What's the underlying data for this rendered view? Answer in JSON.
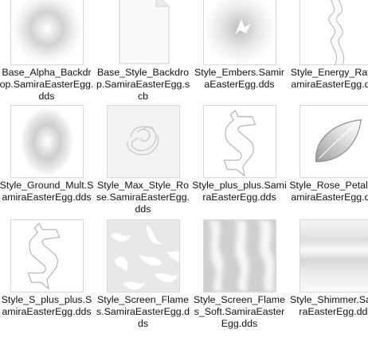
{
  "files": [
    {
      "name": "Base_Alpha_Backdrop.SamiraEasterEgg.dds",
      "icon": "radial-glow-thumbnail"
    },
    {
      "name": "Base_Style_Backdrop.SamiraEasterEgg.scb",
      "icon": "blank-document-icon"
    },
    {
      "name": "Style_Embers.SamiraEasterEgg.dds",
      "icon": "ember-spark-thumbnail"
    },
    {
      "name": "Style_Energy_Ray.SamiraEasterEgg.dds",
      "icon": "energy-ray-thumbnail"
    },
    {
      "name": "Style_Ground_Mult.SamiraEasterEgg.dds",
      "icon": "oval-glow-thumbnail"
    },
    {
      "name": "Style_Max_Style_Rose.SamiraEasterEgg.dds",
      "icon": "rose-thumbnail"
    },
    {
      "name": "Style_plus_plus.SamiraEasterEgg.dds",
      "icon": "s-letter-thumbnail"
    },
    {
      "name": "Style_Rose_Petals.SamiraEasterEgg.dds",
      "icon": "petal-thumbnail"
    },
    {
      "name": "Style_S_plus_plus.SamiraEasterEgg.dds",
      "icon": "s-letter-thumbnail"
    },
    {
      "name": "Style_Screen_Flames.SamiraEasterEgg.dds",
      "icon": "flames-thumbnail"
    },
    {
      "name": "Style_Screen_Flames_Soft.SamiraEasterEgg.dds",
      "icon": "soft-flames-thumbnail"
    },
    {
      "name": "Style_Shimmer.SamiraEasterEgg.dds",
      "icon": "shimmer-gradient-thumbnail"
    }
  ]
}
